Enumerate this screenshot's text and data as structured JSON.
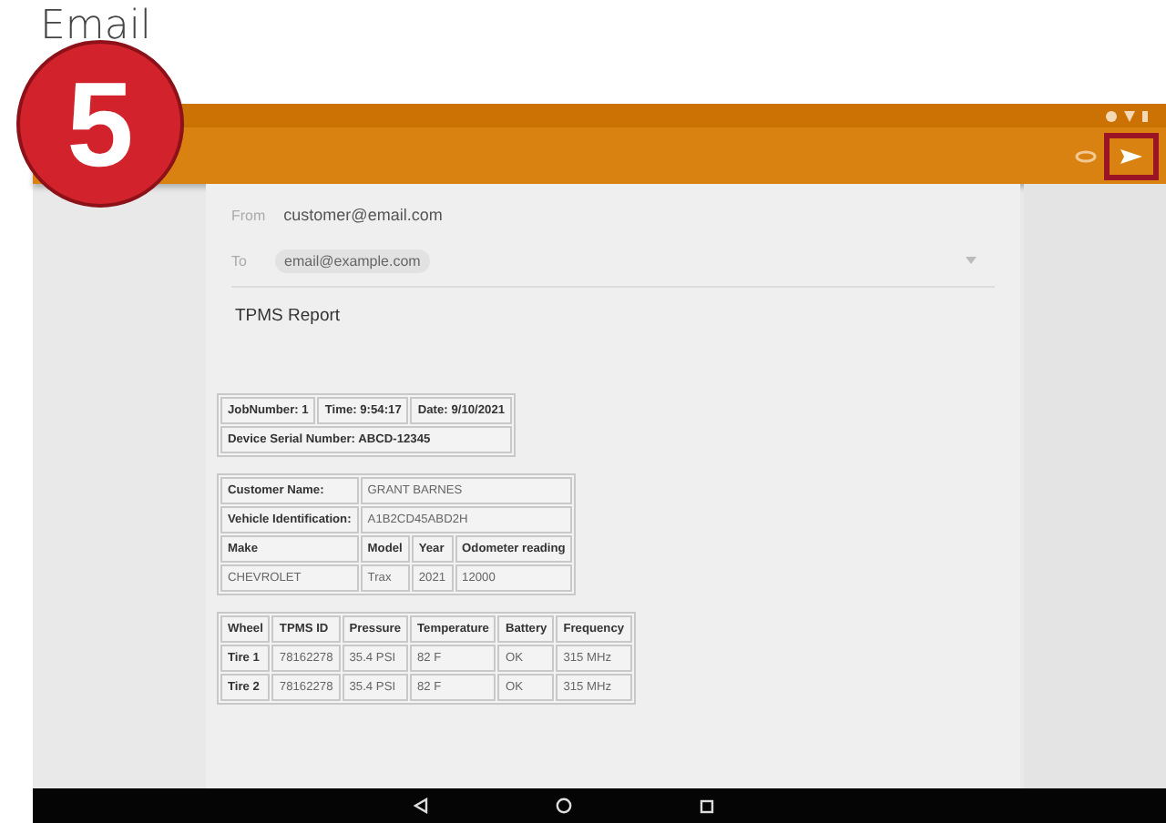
{
  "heading": "Email",
  "step_badge": "5",
  "toolbar": {
    "send_highlighted": true
  },
  "compose": {
    "from_label": "From",
    "from": "customer@email.com",
    "to_label": "To",
    "to_chip": "email@example.com",
    "subject": "TPMS Report"
  },
  "tables": [
    {
      "rows": [
        [
          {
            "text": "JobNumber: 1",
            "kind": "label"
          },
          {
            "text": "Time: 9:54:17",
            "kind": "label"
          },
          {
            "text": "Date: 9/10/2021",
            "kind": "label"
          }
        ],
        [
          {
            "text": "Device Serial Number: ABCD-12345",
            "kind": "label",
            "colspan": 3
          }
        ]
      ]
    },
    {
      "rows": [
        [
          {
            "text": "Customer Name:",
            "kind": "label"
          },
          {
            "text": "GRANT BARNES",
            "kind": "value",
            "colspan": 3
          }
        ],
        [
          {
            "text": "Vehicle Identification:",
            "kind": "label"
          },
          {
            "text": "A1B2CD45ABD2H",
            "kind": "value",
            "colspan": 3
          }
        ],
        [
          {
            "text": "Make",
            "kind": "label"
          },
          {
            "text": "Model",
            "kind": "label"
          },
          {
            "text": "Year",
            "kind": "label"
          },
          {
            "text": "Odometer reading",
            "kind": "label"
          }
        ],
        [
          {
            "text": "CHEVROLET",
            "kind": "value"
          },
          {
            "text": "Trax",
            "kind": "value"
          },
          {
            "text": "2021",
            "kind": "value"
          },
          {
            "text": "12000",
            "kind": "value"
          }
        ]
      ]
    },
    {
      "rows": [
        [
          {
            "text": "Wheel",
            "kind": "label"
          },
          {
            "text": "TPMS ID",
            "kind": "label"
          },
          {
            "text": "Pressure",
            "kind": "label"
          },
          {
            "text": "Temperature",
            "kind": "label"
          },
          {
            "text": "Battery",
            "kind": "label"
          },
          {
            "text": "Frequency",
            "kind": "label"
          }
        ],
        [
          {
            "text": "Tire 1",
            "kind": "label"
          },
          {
            "text": "78162278",
            "kind": "value"
          },
          {
            "text": "35.4 PSI",
            "kind": "value"
          },
          {
            "text": "82 F",
            "kind": "value"
          },
          {
            "text": "OK",
            "kind": "value"
          },
          {
            "text": "315 MHz",
            "kind": "value"
          }
        ],
        [
          {
            "text": "Tire 2",
            "kind": "label"
          },
          {
            "text": "78162278",
            "kind": "value"
          },
          {
            "text": "35.4 PSI",
            "kind": "value"
          },
          {
            "text": "82 F",
            "kind": "value"
          },
          {
            "text": "OK",
            "kind": "value"
          },
          {
            "text": "315 MHz",
            "kind": "value"
          }
        ]
      ]
    }
  ]
}
